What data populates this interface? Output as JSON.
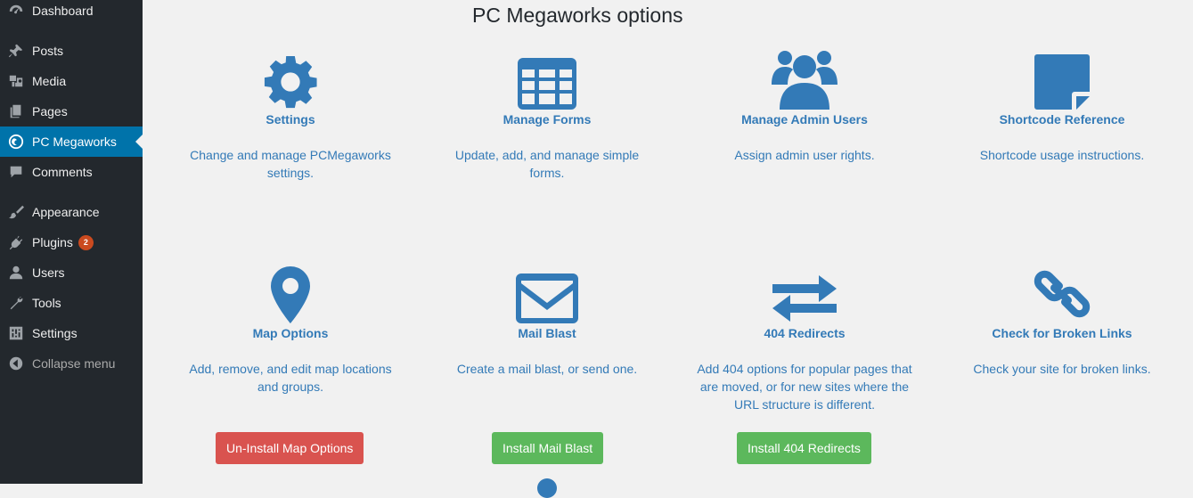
{
  "sidebar": {
    "items": [
      {
        "label": "Dashboard",
        "icon": "dashboard-icon"
      },
      {
        "label": "Posts",
        "icon": "pin-icon"
      },
      {
        "label": "Media",
        "icon": "media-icon"
      },
      {
        "label": "Pages",
        "icon": "pages-icon"
      },
      {
        "label": "PC Megaworks",
        "icon": "pc-megaworks-icon",
        "active": true
      },
      {
        "label": "Comments",
        "icon": "comments-icon"
      },
      {
        "label": "Appearance",
        "icon": "brush-icon"
      },
      {
        "label": "Plugins",
        "icon": "plugin-icon",
        "badge": "2"
      },
      {
        "label": "Users",
        "icon": "user-icon"
      },
      {
        "label": "Tools",
        "icon": "wrench-icon"
      },
      {
        "label": "Settings",
        "icon": "settings-sliders-icon"
      },
      {
        "label": "Collapse menu",
        "icon": "collapse-icon"
      }
    ]
  },
  "main": {
    "title": "PC Megaworks options",
    "cards": [
      {
        "title": "Settings",
        "icon": "gear-icon",
        "desc": "Change and manage PCMegaworks settings."
      },
      {
        "title": "Manage Forms",
        "icon": "table-icon",
        "desc": "Update, add, and manage simple forms."
      },
      {
        "title": "Manage Admin Users",
        "icon": "users-icon",
        "desc": "Assign admin user rights."
      },
      {
        "title": "Shortcode Reference",
        "icon": "sticky-note-icon",
        "desc": "Shortcode usage instructions."
      },
      {
        "title": "Map Options",
        "icon": "map-marker-icon",
        "desc": "Add, remove, and edit map locations and groups."
      },
      {
        "title": "Mail Blast",
        "icon": "envelope-icon",
        "desc": "Create a mail blast, or send one."
      },
      {
        "title": "404 Redirects",
        "icon": "exchange-arrows-icon",
        "desc": "Add 404 options for popular pages that are moved, or for new sites where the URL structure is different."
      },
      {
        "title": "Check for Broken Links",
        "icon": "chain-link-icon",
        "desc": "Check your site for broken links."
      }
    ],
    "buttons": {
      "map_options": "Un-Install Map Options",
      "mail_blast": "Install Mail Blast",
      "redirects": "Install 404 Redirects"
    }
  },
  "colors": {
    "sidebar_bg": "#23282d",
    "active_item": "#0073aa",
    "link_blue": "#337ab7",
    "danger": "#d9534f",
    "success": "#5cb85c",
    "badge": "#ca4a1f"
  }
}
